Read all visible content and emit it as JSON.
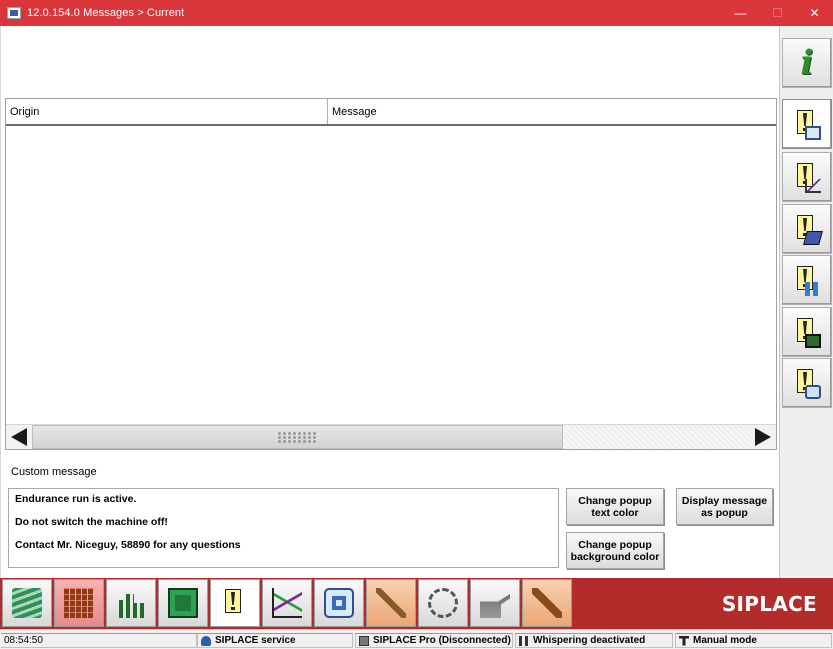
{
  "window": {
    "title": "12.0.154.0 Messages > Current",
    "minimize": "—",
    "maximize": "☐",
    "close": "✕"
  },
  "grid": {
    "columns": [
      "Origin",
      "Message"
    ],
    "rows": []
  },
  "custom_message": {
    "label": "Custom message",
    "lines": [
      "Endurance run is active.",
      "Do not switch the machine off!",
      "Contact Mr. Niceguy, 58890 for any questions"
    ]
  },
  "buttons": {
    "change_text_color": "Change popup\ntext color",
    "display_popup": "Display message\nas popup",
    "change_bg_color": "Change popup\nbackground color"
  },
  "side_toolbar": {
    "items": [
      "info-icon",
      "messages-current-icon",
      "messages-statistics-icon",
      "messages-log-icon",
      "messages-bar-chart-icon",
      "messages-display-icon",
      "messages-camera-icon"
    ]
  },
  "bottom_toolbar": {
    "items": [
      "components-icon",
      "placement-grid-icon",
      "bar-graph-icon",
      "board-icon",
      "messages-icon",
      "line-chart-icon",
      "camera-icon",
      "tools-icon",
      "hand-gear-icon",
      "feeder-oil-icon",
      "wrench-icon"
    ],
    "brand": "SIPLACE"
  },
  "status_bar": {
    "time": "08:54:50",
    "user": "SIPLACE service",
    "connection": "SIPLACE Pro (Disconnected)",
    "whispering": "Whispering deactivated",
    "mode": "Manual mode"
  },
  "colors": {
    "titlebar": "#d9373c",
    "bottom_bar": "#b32c2c",
    "note_yellow": "#fff59a"
  }
}
